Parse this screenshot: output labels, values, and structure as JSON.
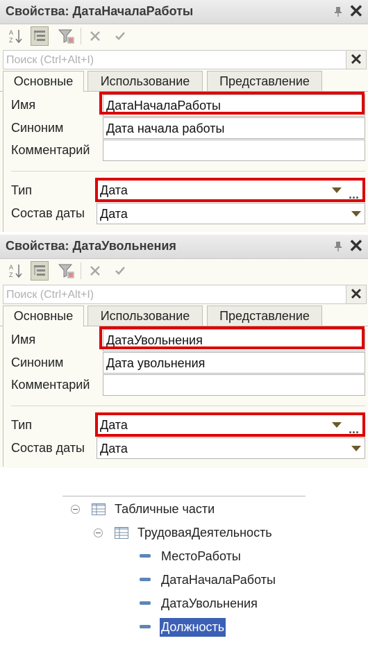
{
  "panels": [
    {
      "title": "Свойства: ДатаНачалаРаботы",
      "search_placeholder": "Поиск (Ctrl+Alt+I)",
      "tabs": [
        "Основные",
        "Использование",
        "Представление"
      ],
      "fields": {
        "name_label": "Имя",
        "name_value": "ДатаНачалаРаботы",
        "synonym_label": "Синоним",
        "synonym_value": "Дата начала работы",
        "comment_label": "Комментарий",
        "comment_value": "",
        "type_label": "Тип",
        "type_value": "Дата",
        "date_composition_label": "Состав даты",
        "date_composition_value": "Дата"
      }
    },
    {
      "title": "Свойства: ДатаУвольнения",
      "search_placeholder": "Поиск (Ctrl+Alt+I)",
      "tabs": [
        "Основные",
        "Использование",
        "Представление"
      ],
      "fields": {
        "name_label": "Имя",
        "name_value": "ДатаУвольнения",
        "synonym_label": "Синоним",
        "synonym_value": "Дата увольнения",
        "comment_label": "Комментарий",
        "comment_value": "",
        "type_label": "Тип",
        "type_value": "Дата",
        "date_composition_label": "Состав даты",
        "date_composition_value": "Дата"
      }
    }
  ],
  "tree": {
    "tabular_sections": "Табличные части",
    "section": "ТрудоваяДеятельность",
    "attributes": [
      "МестоРаботы",
      "ДатаНачалаРаботы",
      "ДатаУвольнения",
      "Должность"
    ],
    "selected": "Должность"
  },
  "colors": {
    "highlight": "#dd0000",
    "selection": "#3c60b5",
    "attribute_icon": "#5d86b7"
  },
  "icons": [
    "sort-az-icon",
    "categories-icon",
    "filter-icon",
    "cancel-icon",
    "apply-icon",
    "pin-icon",
    "close-icon",
    "clear-icon",
    "dropdown-arrow-icon",
    "ellipsis-icon",
    "collapse-icon",
    "table-icon",
    "attribute-icon"
  ]
}
